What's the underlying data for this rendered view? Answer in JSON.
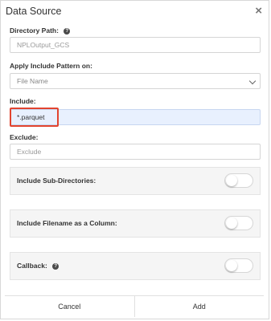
{
  "dialog": {
    "title": "Data Source",
    "close_icon": "close-icon"
  },
  "fields": {
    "directory_path": {
      "label": "Directory Path:",
      "value": "NPLOutput_GCS"
    },
    "apply_pattern": {
      "label": "Apply Include Pattern on:",
      "selected": "File Name"
    },
    "include": {
      "label": "Include:",
      "value": "*.parquet"
    },
    "exclude": {
      "label": "Exclude:",
      "placeholder": "Exclude"
    }
  },
  "toggles": {
    "include_subdirs": {
      "label": "Include Sub-Directories:",
      "on": false
    },
    "filename_column": {
      "label": "Include Filename as a Column:",
      "on": false
    },
    "callback": {
      "label": "Callback:",
      "on": false
    }
  },
  "footer": {
    "cancel_label": "Cancel",
    "add_label": "Add"
  },
  "colors": {
    "highlight": "#e2442f",
    "filled_input": "#e8f0fe"
  }
}
